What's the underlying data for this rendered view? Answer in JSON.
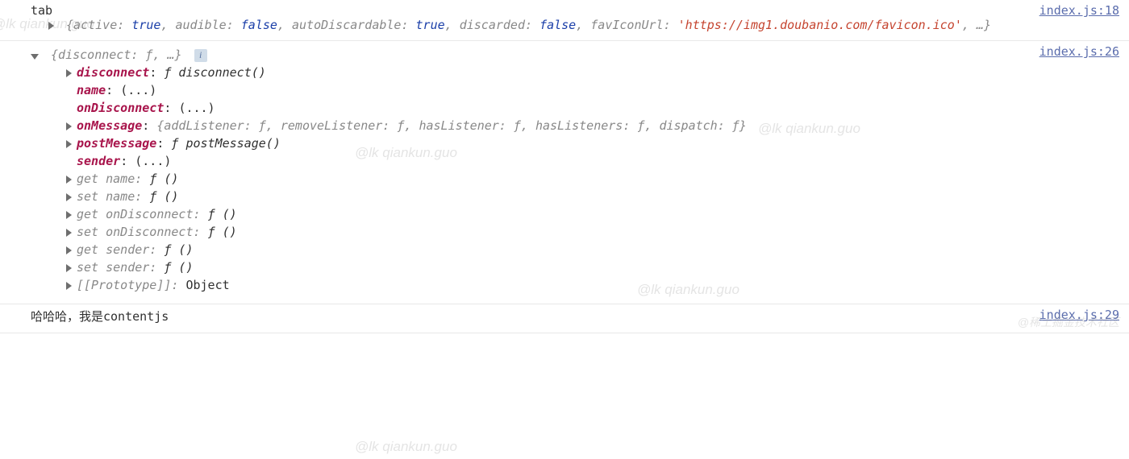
{
  "log1": {
    "label": "tab",
    "src": "index.js:18",
    "preview_parts": [
      "{active: ",
      "true",
      ", audible: ",
      "false",
      ", autoDiscardable: ",
      "true",
      ", discarded: ",
      "false",
      ", favIconUrl: ",
      "'https://img1.doubanio.com/favicon.ico'",
      ", …}"
    ]
  },
  "log2": {
    "src": "index.js:26",
    "summary": "{disconnect: ƒ, …}",
    "info": "i",
    "props": [
      {
        "arrow": true,
        "key": "disconnect",
        "val": "ƒ disconnect()",
        "type": "fn"
      },
      {
        "arrow": false,
        "key": "name",
        "val": "(...)",
        "type": "plain"
      },
      {
        "arrow": false,
        "key": "onDisconnect",
        "val": "(...)",
        "type": "plain"
      },
      {
        "arrow": true,
        "key": "onMessage",
        "val": "{addListener: ƒ, removeListener: ƒ, hasListener: ƒ, hasListeners: ƒ, dispatch: ƒ}",
        "type": "grey"
      },
      {
        "arrow": true,
        "key": "postMessage",
        "val": "ƒ postMessage()",
        "type": "fn"
      },
      {
        "arrow": false,
        "key": "sender",
        "val": "(...)",
        "type": "plain"
      },
      {
        "arrow": true,
        "key": "get name",
        "val": "ƒ ()",
        "type": "fn",
        "accessor": true
      },
      {
        "arrow": true,
        "key": "set name",
        "val": "ƒ ()",
        "type": "fn",
        "accessor": true
      },
      {
        "arrow": true,
        "key": "get onDisconnect",
        "val": "ƒ ()",
        "type": "fn",
        "accessor": true
      },
      {
        "arrow": true,
        "key": "set onDisconnect",
        "val": "ƒ ()",
        "type": "fn",
        "accessor": true
      },
      {
        "arrow": true,
        "key": "get sender",
        "val": "ƒ ()",
        "type": "fn",
        "accessor": true
      },
      {
        "arrow": true,
        "key": "set sender",
        "val": "ƒ ()",
        "type": "fn",
        "accessor": true
      },
      {
        "arrow": true,
        "key": "[[Prototype]]",
        "val": "Object",
        "type": "plain",
        "accessor": true
      }
    ]
  },
  "log3": {
    "msg": "哈哈哈，我是contentjs",
    "src": "index.js:29"
  },
  "watermark": "@lk qiankun.guo",
  "attribution": "@稀土掘金技术社区",
  "colors": {
    "key_purple": "#a8144b",
    "bool_blue": "#1a3ea8",
    "string_red": "#c5442f",
    "link_blue": "#5b6dad",
    "grey": "#888"
  }
}
